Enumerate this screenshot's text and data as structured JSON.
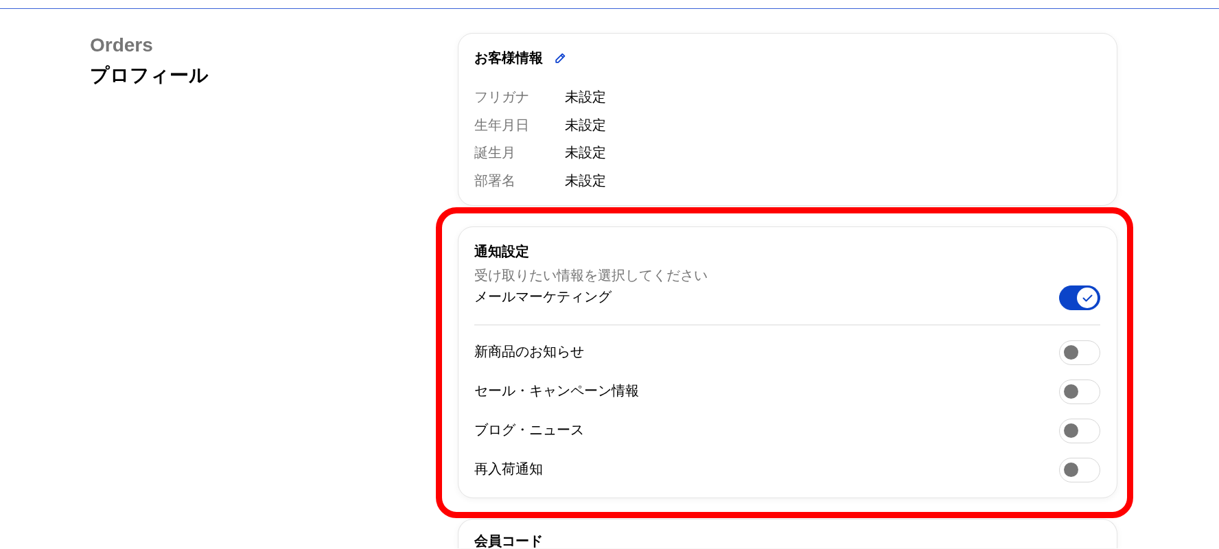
{
  "header": {
    "breadcrumb": "Orders",
    "title": "プロフィール"
  },
  "customer_info": {
    "title": "お客様情報",
    "fields": [
      {
        "label": "フリガナ",
        "value": "未設定"
      },
      {
        "label": "生年月日",
        "value": "未設定"
      },
      {
        "label": "誕生月",
        "value": "未設定"
      },
      {
        "label": "部署名",
        "value": "未設定"
      }
    ]
  },
  "notifications": {
    "highlighted": true,
    "title": "通知設定",
    "subtitle": "受け取りたい情報を選択してください",
    "master": {
      "label": "メールマーケティング",
      "on": true
    },
    "options": [
      {
        "label": "新商品のお知らせ",
        "on": false
      },
      {
        "label": "セール・キャンペーン情報",
        "on": false
      },
      {
        "label": "ブログ・ニュース",
        "on": false
      },
      {
        "label": "再入荷通知",
        "on": false
      }
    ]
  },
  "member_code": {
    "title": "会員コード"
  }
}
